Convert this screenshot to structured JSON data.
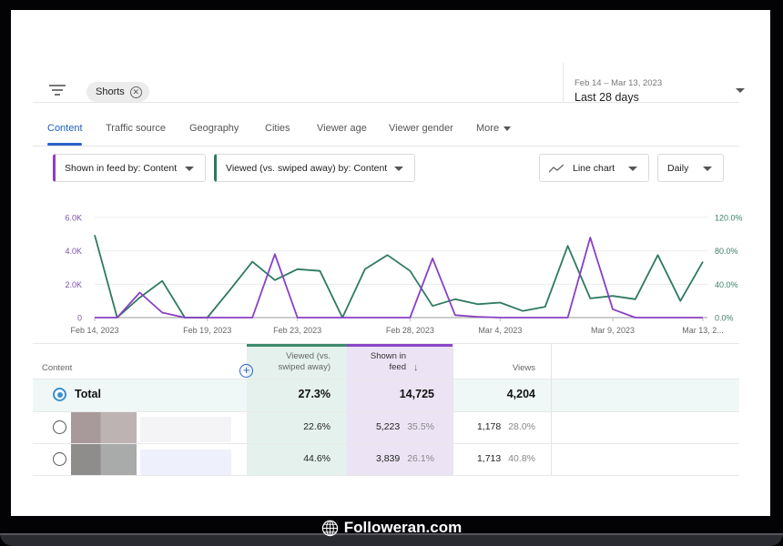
{
  "filter_bar": {
    "filter_icon": "filter-list-icon",
    "chip_label": "Shorts",
    "chip_close_icon": "close-circle-icon"
  },
  "date_picker": {
    "range": "Feb 14 – Mar 13, 2023",
    "label": "Last 28 days",
    "caret_icon": "caret-down-icon"
  },
  "tabs": [
    {
      "label": "Content",
      "active": true
    },
    {
      "label": "Traffic source",
      "active": false
    },
    {
      "label": "Geography",
      "active": false
    },
    {
      "label": "Cities",
      "active": false
    },
    {
      "label": "Viewer age",
      "active": false
    },
    {
      "label": "Viewer gender",
      "active": false
    },
    {
      "label": "More",
      "active": false
    }
  ],
  "selectors": {
    "metric1": "Shown in feed by: Content",
    "metric2": "Viewed (vs. swiped away) by: Content",
    "chart_type": "Line chart",
    "interval": "Daily"
  },
  "colors": {
    "shown_in_feed": "#8a3fc4",
    "viewed": "#2d7a5f",
    "accent": "#2a62c9"
  },
  "chart_data": {
    "type": "line",
    "title": "",
    "x": [
      "Feb 14",
      "Feb 15",
      "Feb 16",
      "Feb 17",
      "Feb 18",
      "Feb 19",
      "Feb 20",
      "Feb 21",
      "Feb 22",
      "Feb 23",
      "Feb 24",
      "Feb 25",
      "Feb 26",
      "Feb 27",
      "Feb 28",
      "Mar 1",
      "Mar 2",
      "Mar 3",
      "Mar 4",
      "Mar 5",
      "Mar 6",
      "Mar 7",
      "Mar 8",
      "Mar 9",
      "Mar 10",
      "Mar 11",
      "Mar 12",
      "Mar 13"
    ],
    "x_tick_labels": [
      "Feb 14, 2023",
      "Feb 19, 2023",
      "Feb 23, 2023",
      "Feb 28, 2023",
      "Mar 4, 2023",
      "Mar 9, 2023",
      "Mar 13, 2..."
    ],
    "x_tick_indices": [
      0,
      5,
      9,
      14,
      18,
      23,
      27
    ],
    "y_left": {
      "label": "Shown in feed",
      "ticks": [
        "0",
        "2.0K",
        "4.0K",
        "6.0K"
      ],
      "range": [
        0,
        6000
      ]
    },
    "y_right": {
      "label": "Viewed (vs. swiped away)",
      "ticks": [
        "0.0%",
        "40.0%",
        "80.0%",
        "120.0%"
      ],
      "range": [
        0,
        120
      ]
    },
    "grid": true,
    "series": [
      {
        "name": "Shown in feed",
        "axis": "left",
        "values": [
          0,
          0,
          1500,
          300,
          0,
          0,
          0,
          0,
          3800,
          0,
          0,
          0,
          0,
          0,
          0,
          3550,
          150,
          50,
          0,
          0,
          0,
          0,
          4800,
          500,
          0,
          0,
          0,
          0
        ]
      },
      {
        "name": "Viewed (vs. swiped away)",
        "axis": "right",
        "values": [
          99,
          0,
          24,
          44,
          0,
          0,
          33,
          67,
          45,
          58,
          56,
          0,
          58,
          75,
          56,
          14,
          22,
          16,
          18,
          8,
          13,
          86,
          23,
          26,
          22,
          75,
          20,
          67
        ]
      }
    ]
  },
  "table": {
    "headers": {
      "content": "Content",
      "viewed": [
        "Viewed (vs.",
        "swiped away)"
      ],
      "shown": [
        "Shown in",
        "feed"
      ],
      "views": "Views"
    },
    "add_column_icon": "add-circle-icon",
    "sort_icon": "arrow-down-icon",
    "total": {
      "label": "Total",
      "viewed": "27.3%",
      "shown": "14,725",
      "views": "4,204"
    },
    "rows": [
      {
        "viewed": "22.6%",
        "shown": "5,223",
        "shown_pct": "35.5%",
        "views": "1,178",
        "views_pct": "28.0%"
      },
      {
        "viewed": "44.6%",
        "shown": "3,839",
        "shown_pct": "26.1%",
        "views": "1,713",
        "views_pct": "40.8%"
      }
    ]
  },
  "watermark": {
    "text": "Followeran.com",
    "icon": "globe-icon"
  }
}
